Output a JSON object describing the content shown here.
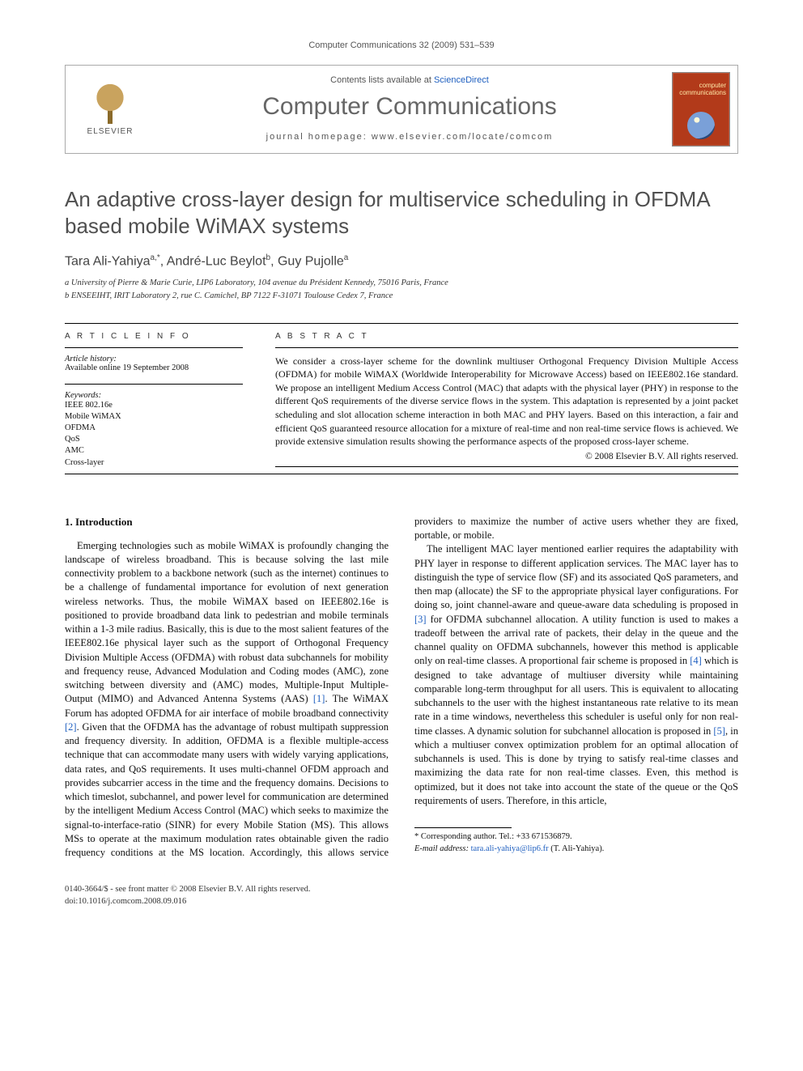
{
  "running_head": "Computer Communications 32 (2009) 531–539",
  "header": {
    "contents_prefix": "Contents lists available at ",
    "contents_link": "ScienceDirect",
    "journal": "Computer Communications",
    "homepage_label": "journal homepage: ",
    "homepage_url": "www.elsevier.com/locate/comcom",
    "publisher": "ELSEVIER",
    "cover_label": "computer communications"
  },
  "title": "An adaptive cross-layer design for multiservice scheduling in OFDMA based mobile WiMAX systems",
  "authors_line": "Tara Ali-Yahiya a,*, André-Luc Beylot b, Guy Pujolle a",
  "affiliations": {
    "a": "a University of Pierre & Marie Curie, LIP6 Laboratory, 104 avenue du Président Kennedy, 75016 Paris, France",
    "b": "b ENSEEIHT, IRIT Laboratory 2, rue C. Camichel, BP 7122 F-31071 Toulouse Cedex 7, France"
  },
  "article_info": {
    "label": "A R T I C L E   I N F O",
    "history_label": "Article history:",
    "history_line": "Available online 19 September 2008",
    "keywords_label": "Keywords:",
    "keywords": [
      "IEEE 802.16e",
      "Mobile WiMAX",
      "OFDMA",
      "QoS",
      "AMC",
      "Cross-layer"
    ]
  },
  "abstract": {
    "label": "A B S T R A C T",
    "text": "We consider a cross-layer scheme for the downlink multiuser Orthogonal Frequency Division Multiple Access (OFDMA) for mobile WiMAX (Worldwide Interoperability for Microwave Access) based on IEEE802.16e standard. We propose an intelligent Medium Access Control (MAC) that adapts with the physical layer (PHY) in response to the different QoS requirements of the diverse service flows in the system. This adaptation is represented by a joint packet scheduling and slot allocation scheme interaction in both MAC and PHY layers. Based on this interaction, a fair and efficient QoS guaranteed resource allocation for a mixture of real-time and non real-time service flows is achieved. We provide extensive simulation results showing the performance aspects of the proposed cross-layer scheme.",
    "copyright": "© 2008 Elsevier B.V. All rights reserved."
  },
  "section1": {
    "heading": "1. Introduction",
    "p1": "Emerging technologies such as mobile WiMAX is profoundly changing the landscape of wireless broadband. This is because solving the last mile connectivity problem to a backbone network (such as the internet) continues to be a challenge of fundamental importance for evolution of next generation wireless networks. Thus, the mobile WiMAX based on IEEE802.16e is positioned to provide broadband data link to pedestrian and mobile terminals within a 1-3 mile radius. Basically, this is due to the most salient features of the IEEE802.16e physical layer such as the support of Orthogonal Frequency Division Multiple Access (OFDMA) with robust data subchannels for mobility and frequency reuse, Advanced Modulation and Coding modes (AMC), zone switching between diversity and (AMC) modes, Multiple-Input Multiple-Output (MIMO) and Advanced Antenna Systems (AAS) ",
    "r1": "[1]",
    "p1b": ". The WiMAX Forum has adopted OFDMA for air interface of mobile broadband connectivity ",
    "r2": "[2]",
    "p1c": ". Given that the OFDMA has the advantage of robust multipath suppression and frequency diversity. In addition, OFDMA is a flexible multiple-access technique that can accommodate many users with widely varying applications, data rates, and QoS requirements. It uses multi-channel OFDM approach and provides subcarrier access in the time and the frequency domains. Decisions to which timeslot, subchannel, and power level for communication are determined by the intelligent Medium Access Con",
    "p2a": "trol (MAC) which seeks to maximize the signal-to-interface-ratio (SINR) for every Mobile Station (MS). This allows MSs to operate at the maximum modulation rates obtainable given the radio frequency conditions at the MS location. Accordingly, this allows service providers to maximize the number of active users whether they are fixed, portable, or mobile.",
    "p3": "The intelligent MAC layer mentioned earlier requires the adaptability with PHY layer in response to different application services. The MAC layer has to distinguish the type of service flow (SF) and its associated QoS parameters, and then map (allocate) the SF to the appropriate physical layer configurations. For doing so, joint channel-aware and queue-aware data scheduling is proposed in ",
    "r3": "[3]",
    "p3b": " for OFDMA subchannel allocation. A utility function is used to makes a tradeoff between the arrival rate of packets, their delay in the queue and the channel quality on OFDMA subchannels, however this method is applicable only on real-time classes. A proportional fair scheme is proposed in ",
    "r4": "[4]",
    "p3c": " which is designed to take advantage of multiuser diversity while maintaining comparable long-term throughput for all users. This is equivalent to allocating subchannels to the user with the highest instantaneous rate relative to its mean rate in a time windows, nevertheless this scheduler is useful only for non real-time classes. A dynamic solution for subchannel allocation is proposed in ",
    "r5": "[5]",
    "p3d": ", in which a multiuser convex optimization problem for an optimal allocation of subchannels is used. This is done by trying to satisfy real-time classes and maximizing the data rate for non real-time classes. Even, this method is optimized, but it does not take into account the state of the queue or the QoS requirements of users. Therefore, in this article,"
  },
  "corresponding": {
    "label": "* Corresponding author. Tel.: +33 671536879.",
    "email_label": "E-mail address:",
    "email": "tara.ali-yahiya@lip6.fr",
    "email_paren": "(T. Ali-Yahiya)."
  },
  "footer": {
    "line1": "0140-3664/$ - see front matter © 2008 Elsevier B.V. All rights reserved.",
    "line2": "doi:10.1016/j.comcom.2008.09.016"
  }
}
